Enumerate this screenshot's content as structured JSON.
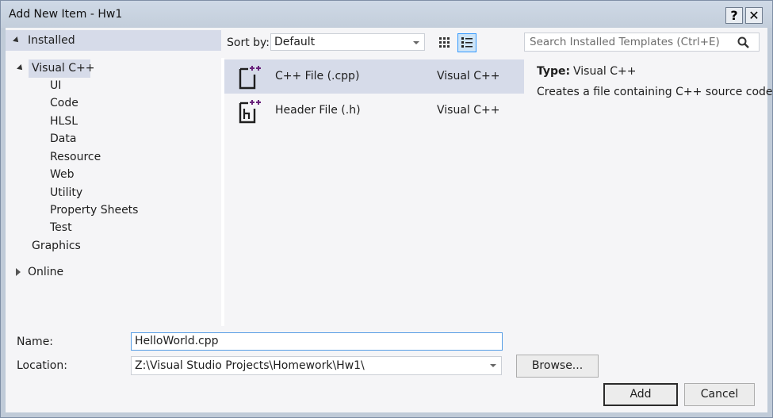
{
  "window": {
    "title": "Add New Item - Hw1",
    "help_label": "?",
    "close_label": "✕"
  },
  "left": {
    "installed_label": "Installed",
    "visual_cpp_label": "Visual C++",
    "children": [
      "UI",
      "Code",
      "HLSL",
      "Data",
      "Resource",
      "Web",
      "Utility",
      "Property Sheets",
      "Test"
    ],
    "graphics_label": "Graphics",
    "online_label": "Online"
  },
  "toolbar": {
    "sort_label": "Sort by:",
    "sort_value": "Default",
    "view_modes": [
      "grid-view-icon",
      "list-view-icon"
    ]
  },
  "templates": [
    {
      "name": "C++ File (.cpp)",
      "language": "Visual C++",
      "icon": "cpp-file-icon",
      "selected": true
    },
    {
      "name": "Header File (.h)",
      "language": "Visual C++",
      "icon": "header-file-icon",
      "selected": false
    }
  ],
  "search": {
    "placeholder": "Search Installed Templates (Ctrl+E)",
    "icon": "search-icon"
  },
  "details": {
    "type_label": "Type:",
    "type_value": "Visual C++",
    "description": "Creates a file containing C++ source code"
  },
  "form": {
    "name_label": "Name:",
    "name_value": "HelloWorld.cpp",
    "location_label": "Location:",
    "location_value": "Z:\\Visual Studio Projects\\Homework\\Hw1\\",
    "browse_label": "Browse...",
    "add_label": "Add",
    "cancel_label": "Cancel"
  },
  "colors": {
    "selection": "#d6dbe9",
    "accent_purple": "#68217a",
    "focus_border": "#569de5"
  }
}
